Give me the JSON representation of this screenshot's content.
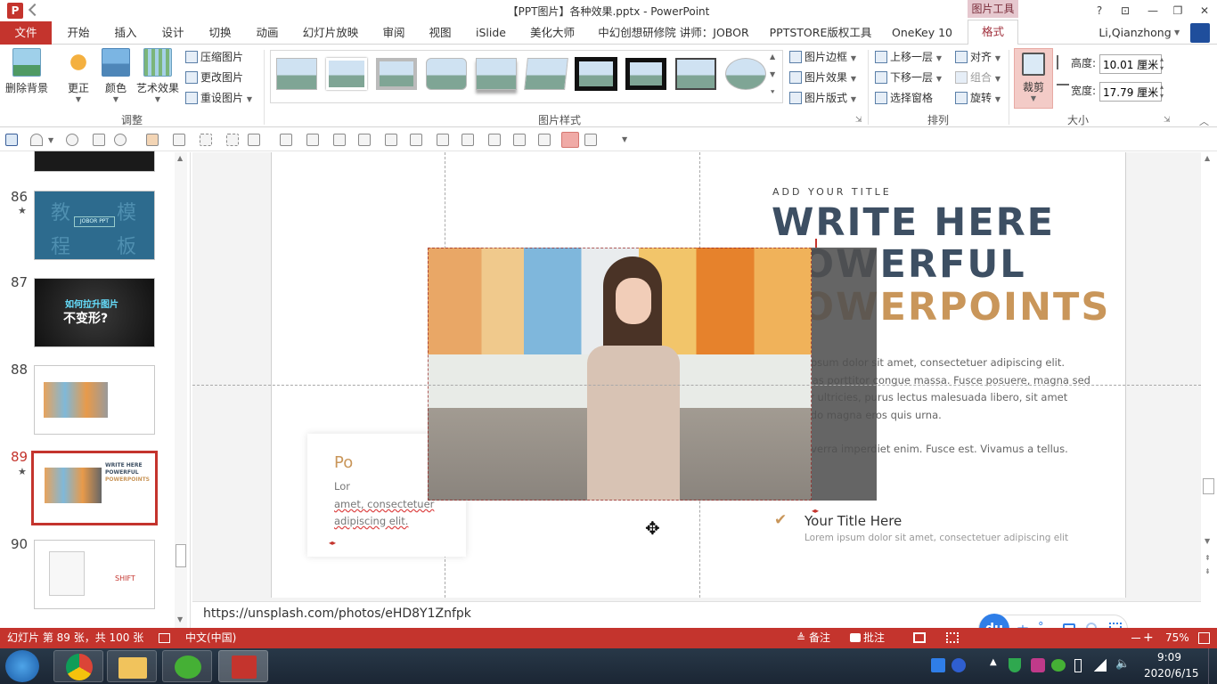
{
  "app": {
    "title": "【PPT图片】各种效果.pptx - PowerPoint",
    "tool_group": "图片工具",
    "user": "Li,Qianzhong",
    "logo": "P"
  },
  "tabs": [
    "开始",
    "插入",
    "设计",
    "切换",
    "动画",
    "幻灯片放映",
    "审阅",
    "视图",
    "iSlide",
    "美化大师",
    "中幻创想研修院 讲师：JOBOR",
    "PPTSTORE版权工具",
    "OneKey 10"
  ],
  "file_tab": "文件",
  "format_tab": "格式",
  "ribbon": {
    "adjust": {
      "label": "调整",
      "remove_bg": "删除背景",
      "corrections": "更正",
      "color": "颜色",
      "artistic": "艺术效果",
      "compress": "压缩图片",
      "change": "更改图片",
      "reset": "重设图片"
    },
    "styles": {
      "label": "图片样式",
      "border": "图片边框",
      "effects": "图片效果",
      "layout": "图片版式"
    },
    "arrange": {
      "label": "排列",
      "bring_forward": "上移一层",
      "send_backward": "下移一层",
      "selection_pane": "选择窗格",
      "align": "对齐",
      "group": "组合",
      "rotate": "旋转"
    },
    "size": {
      "label": "大小",
      "crop": "裁剪",
      "height_label": "高度:",
      "height_value": "10.01 厘米",
      "width_label": "宽度:",
      "width_value": "17.79 厘米"
    }
  },
  "slides": [
    {
      "num": "86",
      "star": "★"
    },
    {
      "num": "87",
      "star": ""
    },
    {
      "num": "88",
      "star": ""
    },
    {
      "num": "89",
      "star": "★"
    },
    {
      "num": "90",
      "star": ""
    }
  ],
  "thumb_text": {
    "s86_a": "教",
    "s86_b": "模",
    "s86_c": "程",
    "s86_d": "板",
    "s86_label": "JOBOR PPT",
    "s87_line1": "如何拉升图片",
    "s87_line2": "不变形?",
    "s89_title1": "WRITE HERE",
    "s89_title2": "POWERFUL",
    "s89_title3": "POWERPOINTS",
    "s90_right": "SHIFT"
  },
  "slide": {
    "kicker": "ADD YOUR TITLE",
    "title_line1": "WRITE HERE",
    "title_line2": "POWERFUL",
    "title_line3": "POWERPOINTS",
    "body1": "Lorem ipsum dolor sit amet, consectetuer adipiscing elit. Maecenas porttitor congue massa. Fusce posuere, magna sed pulvinar ultricies, purus lectus malesuada libero, sit amet commodo magna eros quis urna.",
    "body2": "Nunc viverra imperdiet enim. Fusce est. Vivamus a tellus.",
    "item_title": "Your Title Here",
    "item_sub": "Lorem ipsum dolor sit amet, consectetuer adipiscing elit",
    "card_title": "Po",
    "card_text1": "Lor",
    "card_text2": "amet, consectetuer",
    "card_text3": "adipiscing elit.",
    "accent_color": "#c9965a",
    "title_color": "#3d4f63"
  },
  "notes_text": "https://unsplash.com/photos/eHD8Y1Znfpk",
  "status": {
    "slide_info": "幻灯片 第 89 张，共 100 张",
    "language": "中文(中国)",
    "notes": "备注",
    "comments": "批注",
    "zoom": "75%"
  },
  "ime": [
    "中",
    "°,"
  ],
  "taskbar": {
    "time": "9:09",
    "date": "2020/6/15"
  }
}
